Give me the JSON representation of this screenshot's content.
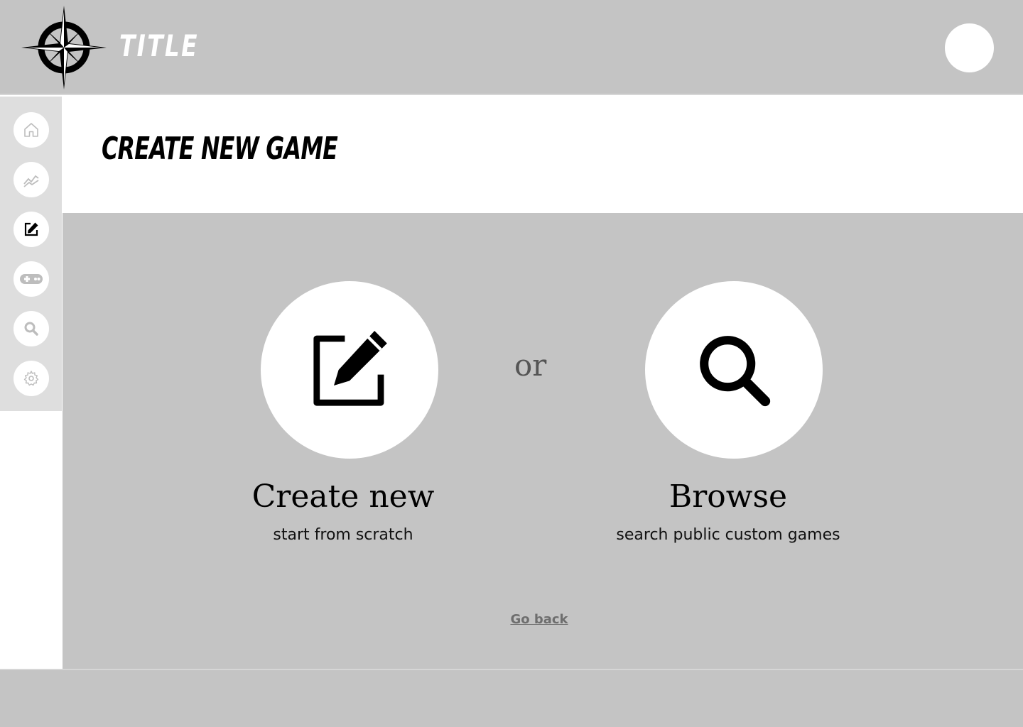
{
  "header": {
    "brand_title": "TITLE",
    "logo_icon": "compass-rose-icon",
    "avatar_icon": "user-avatar"
  },
  "sidebar": {
    "items": [
      {
        "icon": "home-icon",
        "active": false
      },
      {
        "icon": "chart-line-icon",
        "active": false
      },
      {
        "icon": "edit-icon",
        "active": true
      },
      {
        "icon": "gamepad-icon",
        "active": false
      },
      {
        "icon": "search-icon",
        "active": false
      },
      {
        "icon": "gear-icon",
        "active": false
      }
    ]
  },
  "page": {
    "title": "Create new game"
  },
  "options": {
    "create": {
      "icon": "edit-icon",
      "title": "Create new",
      "subtitle": "start from scratch"
    },
    "separator": "or",
    "browse": {
      "icon": "search-icon",
      "title": "Browse",
      "subtitle": "search public custom games"
    }
  },
  "actions": {
    "go_back_label": "Go back"
  },
  "colors": {
    "panel_gray": "#c4c4c4",
    "sidebar_gray": "#dedede",
    "white": "#ffffff",
    "icon_inactive": "#bdbdbd",
    "icon_active": "#000000"
  }
}
